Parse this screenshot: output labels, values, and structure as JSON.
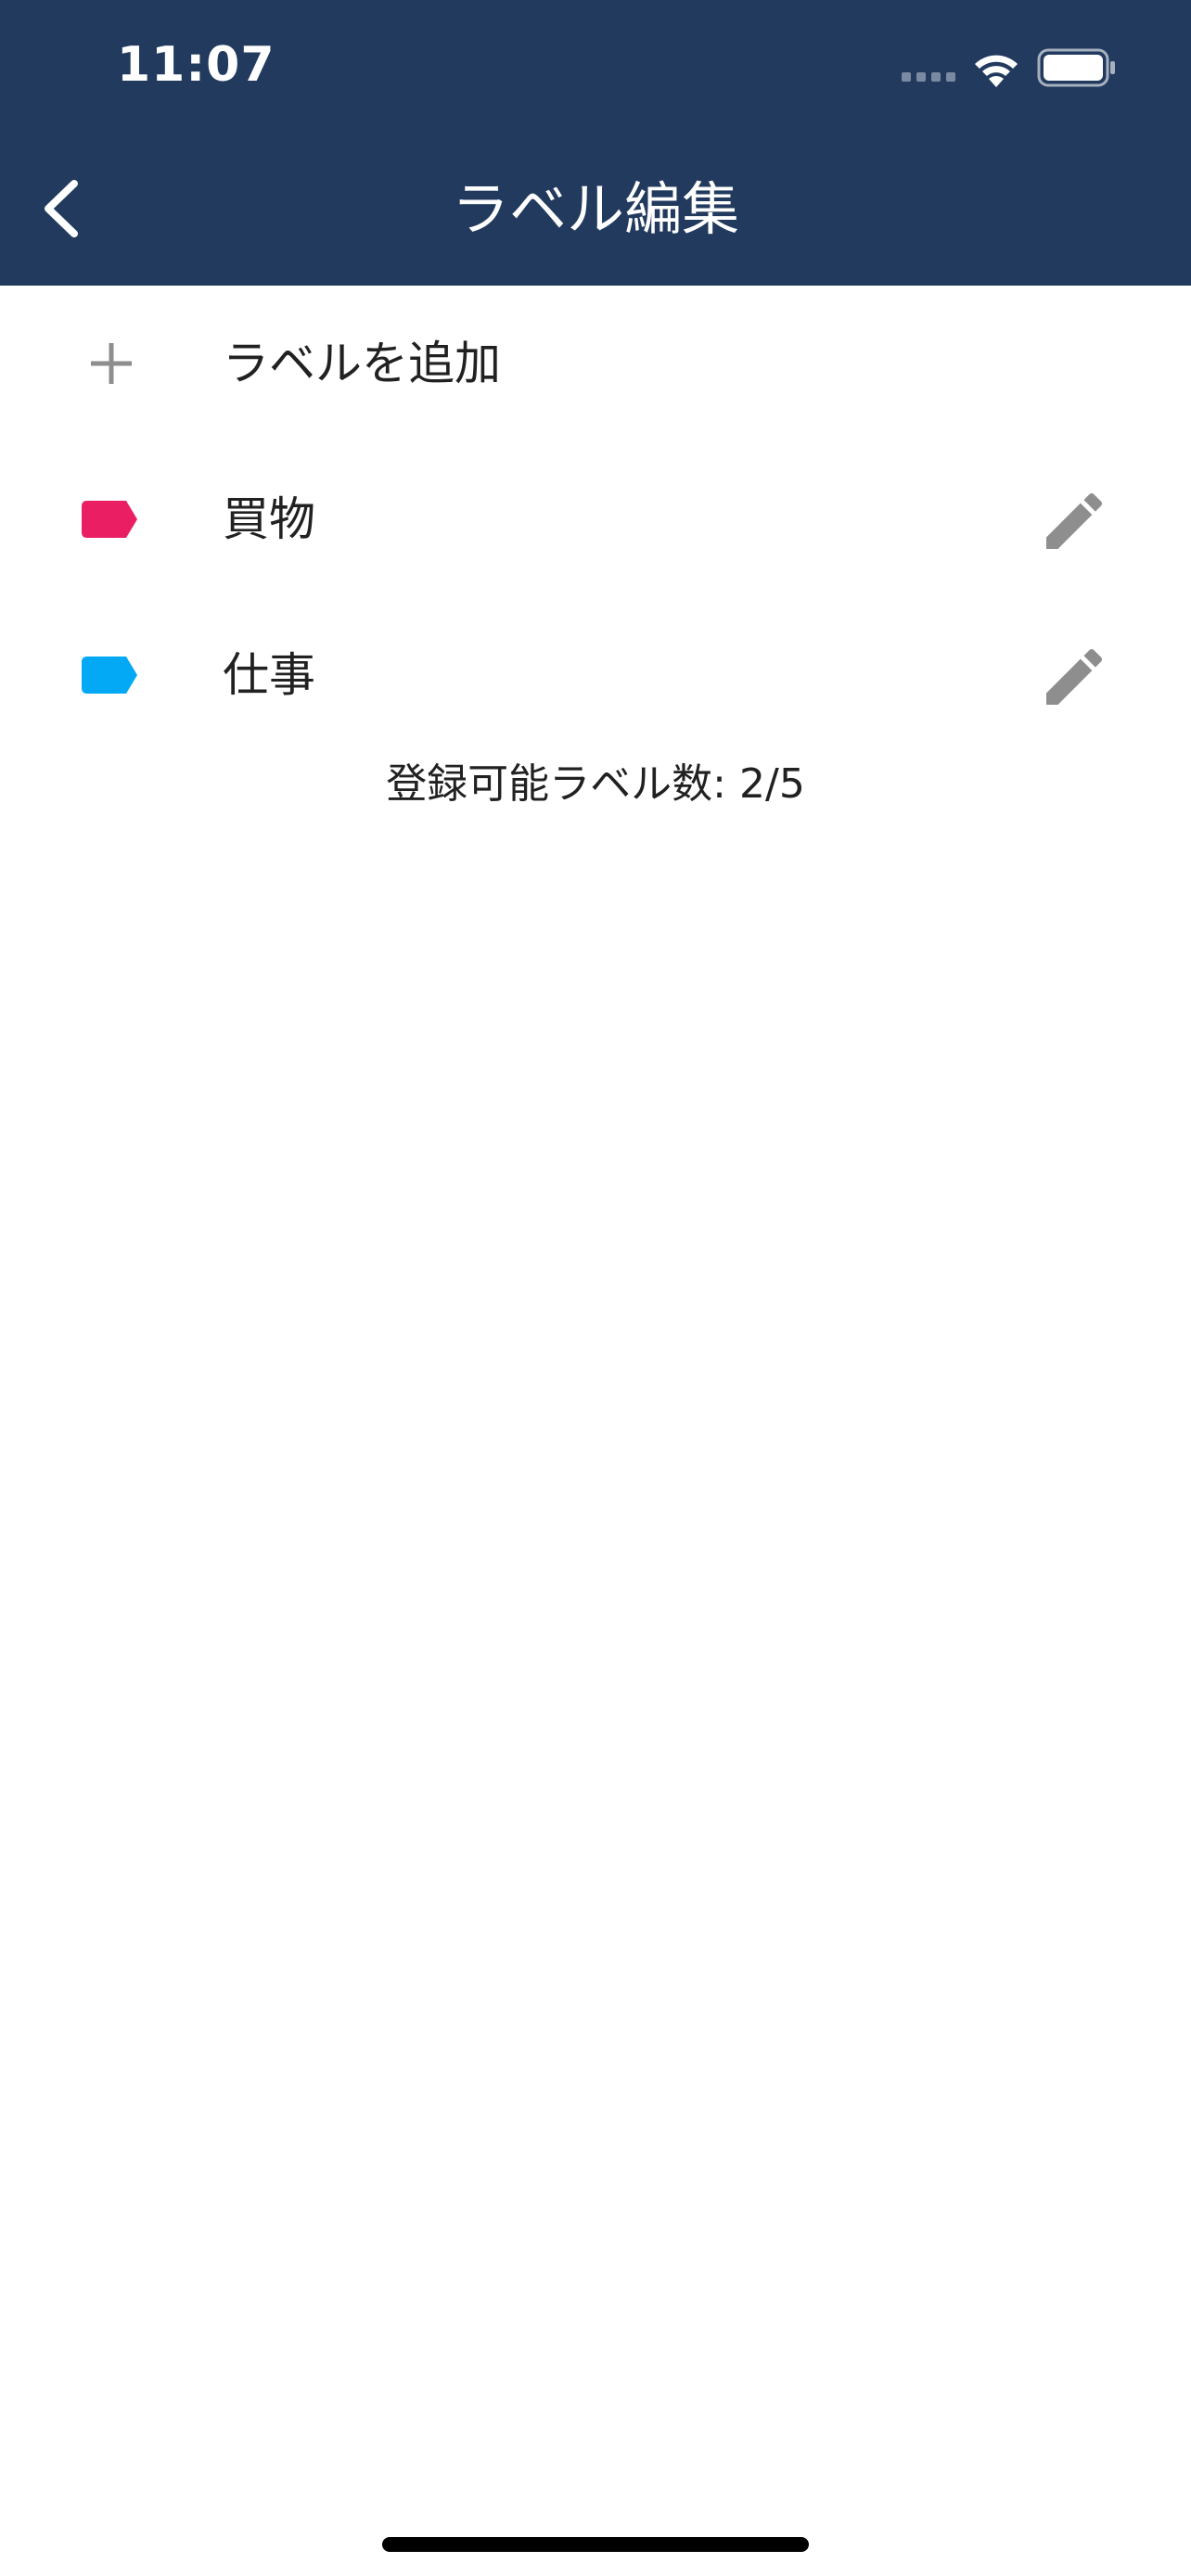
{
  "status_bar": {
    "time": "11:07"
  },
  "header": {
    "title": "ラベル編集",
    "back_icon": "chevron-left-icon",
    "background_color": "#223a5e"
  },
  "add_row": {
    "label": "ラベルを追加",
    "icon": "plus-icon"
  },
  "labels": [
    {
      "name": "買物",
      "color": "#e91e63",
      "icon": "label-tag-icon",
      "edit_icon": "pencil-icon"
    },
    {
      "name": "仕事",
      "color": "#03a9f4",
      "icon": "label-tag-icon",
      "edit_icon": "pencil-icon"
    }
  ],
  "footer": {
    "count_text": "登録可能ラベル数: 2/5"
  }
}
